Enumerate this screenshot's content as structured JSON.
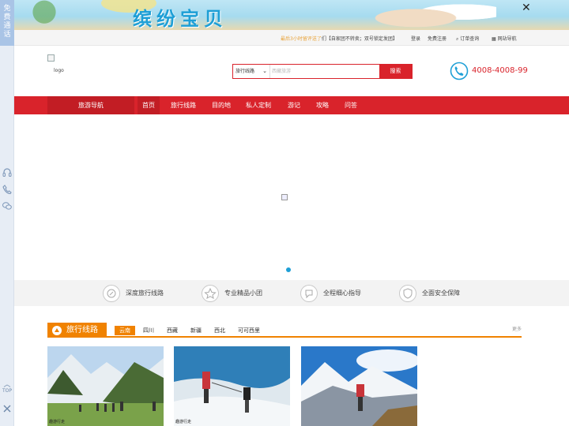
{
  "sidebar": {
    "free_call": "免费通话",
    "top_label": "TOP"
  },
  "banner": {
    "headline": "缤纷宝贝",
    "close_label": "✕"
  },
  "util": {
    "notice_highlight": "最后3小时留评送了",
    "notice_text": "们【自家团不转卖；双号锁定发团】",
    "login": "登录",
    "register": "免费注册",
    "order_query": "订单查询",
    "site_nav": "网站导航"
  },
  "header": {
    "logo_alt": "logo",
    "search_select": "旅行线路",
    "search_placeholder": "西藏旅游",
    "search_button": "搜索",
    "phone": "4008-4008-99"
  },
  "nav": {
    "guide": "旅游导航",
    "items": [
      "首页",
      "旅行线路",
      "目的地",
      "私人定制",
      "游记",
      "攻略",
      "问答"
    ]
  },
  "features": [
    "深度旅行线路",
    "专业精品小团",
    "全程细心指导",
    "全面安全保障"
  ],
  "section": {
    "title": "旅行线路",
    "tabs": [
      "云南",
      "四川",
      "西藏",
      "新疆",
      "西北",
      "可可西里"
    ],
    "more": "更多"
  },
  "cards": [
    {
      "watermark": "趣游行走"
    },
    {
      "watermark": "趣游行走"
    },
    {
      "watermark": ""
    }
  ],
  "colors": {
    "brand_red": "#d9232b",
    "accent_orange": "#f08200",
    "slider_dot": "#1e9fd6"
  }
}
